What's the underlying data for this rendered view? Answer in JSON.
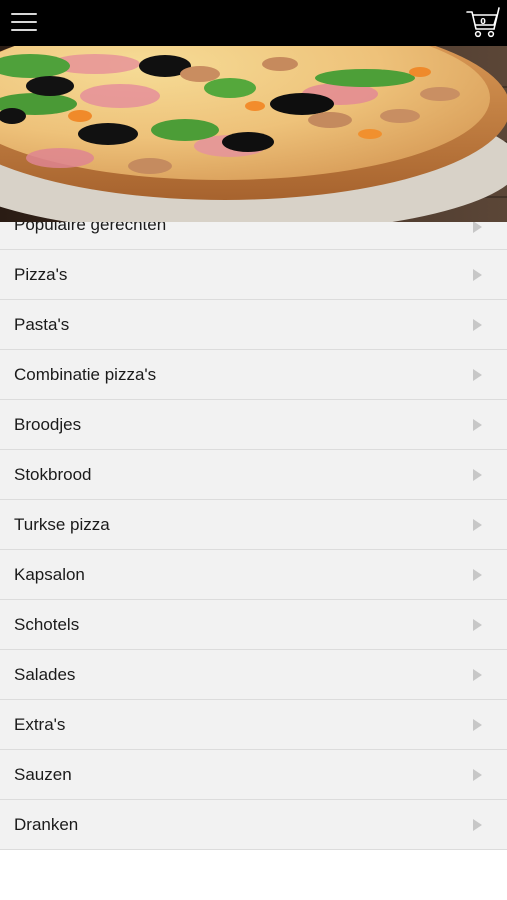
{
  "header": {
    "menu_icon": "hamburger-menu-icon",
    "cart_icon": "shopping-cart-icon",
    "cart_count": "0",
    "background_color": "#000000"
  },
  "hero": {
    "image": "pizza-photo"
  },
  "categories": [
    {
      "label": "Populaire gerechten",
      "icon": "chevron-right-icon"
    },
    {
      "label": "Pizza's",
      "icon": "chevron-right-icon"
    },
    {
      "label": "Pasta's",
      "icon": "chevron-right-icon"
    },
    {
      "label": "Combinatie pizza's",
      "icon": "chevron-right-icon"
    },
    {
      "label": "Broodjes",
      "icon": "chevron-right-icon"
    },
    {
      "label": "Stokbrood",
      "icon": "chevron-right-icon"
    },
    {
      "label": "Turkse pizza",
      "icon": "chevron-right-icon"
    },
    {
      "label": "Kapsalon",
      "icon": "chevron-right-icon"
    },
    {
      "label": "Schotels",
      "icon": "chevron-right-icon"
    },
    {
      "label": "Salades",
      "icon": "chevron-right-icon"
    },
    {
      "label": "Extra's",
      "icon": "chevron-right-icon"
    },
    {
      "label": "Sauzen",
      "icon": "chevron-right-icon"
    },
    {
      "label": "Dranken",
      "icon": "chevron-right-icon"
    }
  ],
  "colors": {
    "list_background": "#f2f2f2",
    "divider": "#dcdcdc",
    "arrow": "#c7c7c7",
    "text": "#1b1b1b"
  }
}
